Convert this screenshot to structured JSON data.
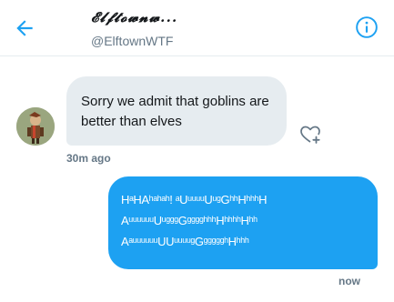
{
  "header": {
    "title": "𝓔𝓵𝓯𝓽𝓸𝔀𝓷𝔀...",
    "handle": "@ElftownWTF"
  },
  "messages": [
    {
      "direction": "incoming",
      "text": "Sorry we admit that goblins are better than elves",
      "time": "30m ago"
    },
    {
      "direction": "outgoing",
      "lines": [
        "HᵃHAʰᵃʰᵃʰ! ᵃUᵘᵘᵘᵘUᵘᵍGʰʰHʰʰʰH",
        "AᵘᵘᵘᵘᵘᵘUᵘᵍᵍᵍGᵍᵍᵍᵍʰʰʰHʰʰʰʰHʰʰ",
        "AᵃᵘᵘᵘᵘᵘᵘUUᵘᵘᵘᵘᵍGᵍᵍᵍᵍᵍʰHʰʰʰ"
      ],
      "time": "now"
    }
  ],
  "icons": {
    "back": "arrow-left-icon",
    "info": "info-icon",
    "react": "heart-plus-icon"
  },
  "colors": {
    "accent": "#1da1f2",
    "incoming_bubble": "#e6ecf0",
    "muted_text": "#657786"
  }
}
